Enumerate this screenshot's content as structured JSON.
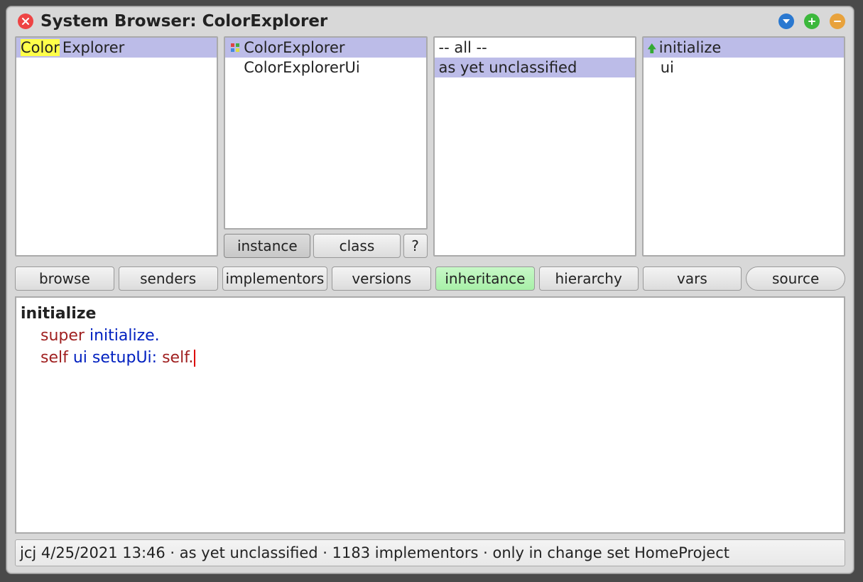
{
  "window": {
    "title": "System Browser: ColorExplorer"
  },
  "pane1": {
    "items": [
      {
        "label": "ColorExplorer",
        "selected": true,
        "highlight_prefix": "Color"
      }
    ]
  },
  "pane2": {
    "items": [
      {
        "label": "ColorExplorer",
        "selected": true,
        "icon": "squares"
      },
      {
        "label": "ColorExplorerUi",
        "selected": false
      }
    ],
    "buttons": {
      "instance": "instance",
      "class": "class",
      "help": "?"
    },
    "active_button": "instance"
  },
  "pane3": {
    "items": [
      {
        "label": "-- all --",
        "selected": false
      },
      {
        "label": "as yet unclassified",
        "selected": true
      }
    ]
  },
  "pane4": {
    "items": [
      {
        "label": "initialize",
        "selected": true,
        "icon": "up-arrow"
      },
      {
        "label": "ui",
        "selected": false
      }
    ]
  },
  "toolbar": {
    "browse": "browse",
    "senders": "senders",
    "implementors": "implementors",
    "versions": "versions",
    "inheritance": "inheritance",
    "hierarchy": "hierarchy",
    "vars": "vars",
    "source": "source"
  },
  "code": {
    "selector": "initialize",
    "line1_rcv": "super",
    "line1_kw": "initialize.",
    "line2_rcv": "self",
    "line2_kw1": "ui",
    "line2_kw2": "setupUi:",
    "line2_arg": "self."
  },
  "status": "jcj 4/25/2021 13:46 · as yet unclassified · 1183 implementors · only in change set HomeProject"
}
